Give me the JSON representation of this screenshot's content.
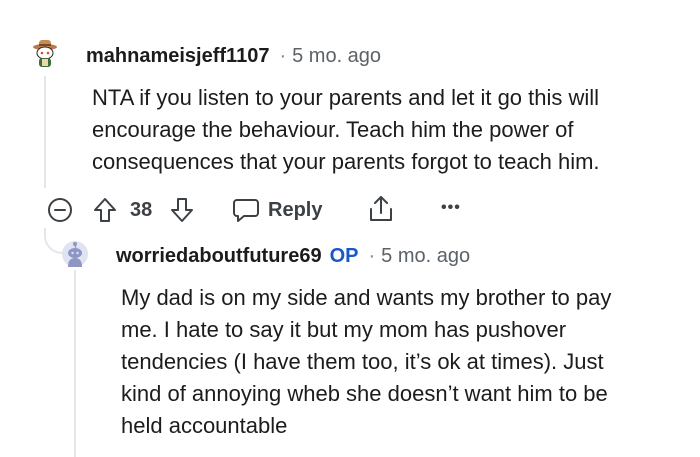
{
  "comment1": {
    "username": "mahnameisjeff1107",
    "separator": "·",
    "time": "5 mo. ago",
    "text_lines": [
      "NTA if you listen to your parents and let it go this will",
      "encourage the behaviour. Teach him the power of",
      "consequences that your parents forgot to teach him."
    ],
    "score": "38",
    "reply_label": "Reply",
    "more_label": "•••"
  },
  "comment2": {
    "username": "worriedaboutfuture69",
    "op_badge": "OP",
    "separator": "·",
    "time": "5 mo. ago",
    "text_lines": [
      "My dad is on my side and wants my brother to pay",
      "me. I hate to say it but my mom has pushover",
      "tendencies (I have them too, it’s ok at times). Just",
      "kind of annoying wheb she doesn’t want him to be",
      "held accountable"
    ]
  },
  "icons": {
    "avatar1": "snoo-cowboy-avatar-icon",
    "avatar2": "snoo-default-avatar-icon",
    "collapse": "minus-circle-icon",
    "upvote": "arrow-up-icon",
    "downvote": "arrow-down-icon",
    "reply": "speech-bubble-icon",
    "share": "share-icon",
    "more": "more-dots-icon"
  },
  "colors": {
    "op_badge": "#1958c9",
    "thread_line": "#e4e7e9",
    "meta_text": "#5b6268"
  }
}
